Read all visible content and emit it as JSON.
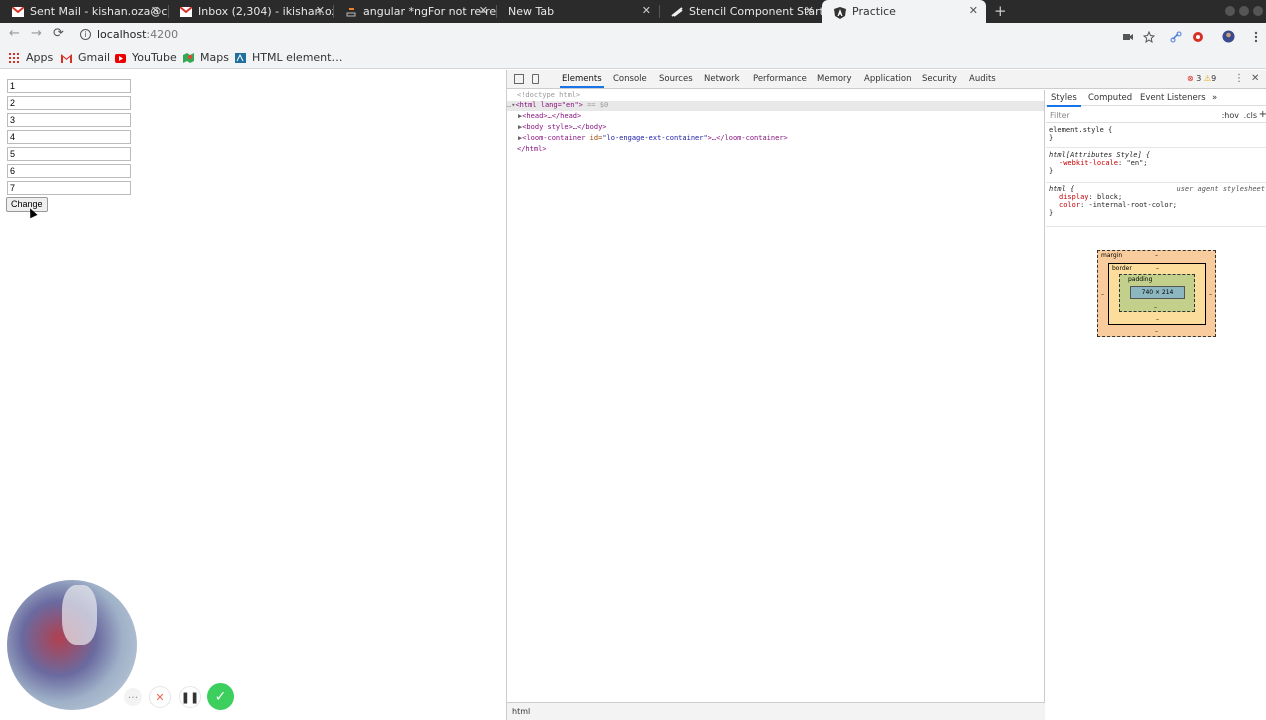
{
  "browser": {
    "tabs": [
      {
        "title": "Sent Mail - kishan.oza@c",
        "icon": "gmail-icon"
      },
      {
        "title": "Inbox (2,304) - ikishan.oz",
        "icon": "gmail-icon"
      },
      {
        "title": "angular *ngFor not re-re",
        "icon": "stackoverflow-icon"
      },
      {
        "title": "New Tab",
        "icon": ""
      },
      {
        "title": "Stencil Component Start",
        "icon": "stencil-icon"
      },
      {
        "title": "Practice",
        "icon": "angular-icon"
      }
    ],
    "url_host": "localhost",
    "url_port": ":4200",
    "bookmarks": [
      {
        "label": "Apps",
        "icon": "apps-grid-icon"
      },
      {
        "label": "Gmail",
        "icon": "gmail-icon"
      },
      {
        "label": "YouTube",
        "icon": "youtube-icon"
      },
      {
        "label": "Maps",
        "icon": "maps-icon"
      },
      {
        "label": "HTML element…",
        "icon": "mdn-icon"
      }
    ]
  },
  "page": {
    "inputs": [
      "1",
      "2",
      "3",
      "4",
      "5",
      "6",
      "7"
    ],
    "change_button": "Change"
  },
  "devtools": {
    "tabs": [
      "Elements",
      "Console",
      "Sources",
      "Network",
      "Performance",
      "Memory",
      "Application",
      "Security",
      "Audits"
    ],
    "errors": "3",
    "warnings": "9",
    "dom": {
      "doctype": "<!doctype html>",
      "html_open": "<html lang=\"en\">",
      "html_suffix": "== $0",
      "head": "<head>…</head>",
      "body": "<body style>…</body>",
      "loom_tag": "<loom-container",
      "loom_attr": "id=",
      "loom_val": "\"lo-engage-ext-container\"",
      "loom_close": ">…</loom-container>",
      "html_close": "</html>"
    },
    "breadcrumb": "html",
    "styles_tabs": [
      "Styles",
      "Computed",
      "Event Listeners"
    ],
    "filter_placeholder": "Filter",
    "hov": ":hov",
    "cls": ".cls",
    "rules": {
      "element_style": "element.style {",
      "close": "}",
      "attr_style": "html[Attributes Style] {",
      "attr_prop": "-webkit-locale",
      "attr_val": ": \"en\";",
      "html_sel": "html {",
      "ua": "user agent stylesheet",
      "display_prop": "display",
      "display_val": ": block;",
      "color_prop": "color",
      "color_val": ": -internal-root-color;"
    },
    "box_model": {
      "margin": "margin",
      "border": "border",
      "padding": "padding",
      "content": "740 × 214",
      "dash": "–"
    }
  },
  "recorder": {
    "more": "···",
    "stop": "✕",
    "pause": "❚❚",
    "done": "✓"
  }
}
